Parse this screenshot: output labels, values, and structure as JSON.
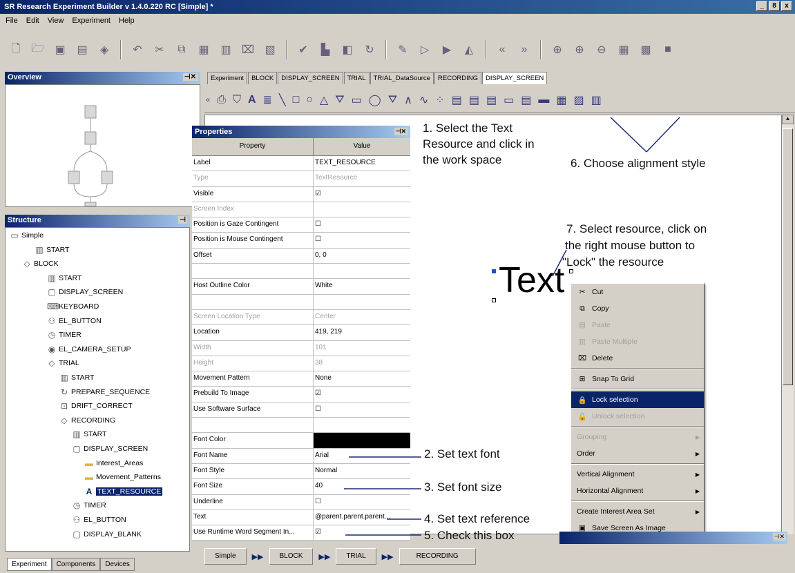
{
  "window": {
    "title": "SR Research Experiment Builder v 1.4.0.220 RC  [Simple] *",
    "min": "_",
    "max": "8",
    "close": "x"
  },
  "menu": [
    "File",
    "Edit",
    "View",
    "Experiment",
    "Help"
  ],
  "overview": {
    "title": "Overview"
  },
  "structure": {
    "title": "Structure",
    "items": [
      {
        "label": "Simple",
        "icon": "project-icon"
      },
      {
        "label": "START",
        "icon": "start-icon"
      },
      {
        "label": "BLOCK",
        "icon": "sequence-icon"
      },
      {
        "label": "START",
        "icon": "start-icon"
      },
      {
        "label": "DISPLAY_SCREEN",
        "icon": "display-icon"
      },
      {
        "label": "KEYBOARD",
        "icon": "keyboard-icon"
      },
      {
        "label": "EL_BUTTON",
        "icon": "button-icon"
      },
      {
        "label": "TIMER",
        "icon": "timer-icon"
      },
      {
        "label": "EL_CAMERA_SETUP",
        "icon": "camera-icon"
      },
      {
        "label": "TRIAL",
        "icon": "sequence-icon"
      },
      {
        "label": "START",
        "icon": "start-icon"
      },
      {
        "label": "PREPARE_SEQUENCE",
        "icon": "prepare-icon"
      },
      {
        "label": "DRIFT_CORRECT",
        "icon": "drift-icon"
      },
      {
        "label": "RECORDING",
        "icon": "sequence-icon"
      },
      {
        "label": "START",
        "icon": "start-icon"
      },
      {
        "label": "DISPLAY_SCREEN",
        "icon": "display-icon"
      },
      {
        "label": "Interest_Areas",
        "icon": "folder-icon"
      },
      {
        "label": "Movement_Patterns",
        "icon": "folder-icon"
      },
      {
        "label": "TEXT_RESOURCE",
        "icon": "text-icon"
      },
      {
        "label": "TIMER",
        "icon": "timer-icon"
      },
      {
        "label": "EL_BUTTON",
        "icon": "button-icon"
      },
      {
        "label": "DISPLAY_BLANK",
        "icon": "display-icon"
      }
    ]
  },
  "bottom_tabs": [
    "Experiment",
    "Components",
    "Devices"
  ],
  "editor_tabs": [
    "Experiment",
    "BLOCK",
    "DISPLAY_SCREEN",
    "TRIAL",
    "TRIAL_DataSource",
    "RECORDING",
    "DISPLAY_SCREEN"
  ],
  "properties": {
    "title": "Properties",
    "col_property": "Property",
    "col_value": "Value",
    "rows": [
      {
        "p": "Label",
        "v": "TEXT_RESOURCE"
      },
      {
        "p": "Type",
        "v": "TextResource",
        "dim": true
      },
      {
        "p": "Visible",
        "v": "☑"
      },
      {
        "p": "Screen Index",
        "v": "",
        "dim": true
      },
      {
        "p": "Position is Gaze Contingent",
        "v": "☐"
      },
      {
        "p": "Position is Mouse Contingent",
        "v": "☐"
      },
      {
        "p": "Offset",
        "v": "0, 0"
      },
      {
        "p": "",
        "v": ""
      },
      {
        "p": "Host Outline Color",
        "v": "White"
      },
      {
        "p": "",
        "v": ""
      },
      {
        "p": "Screen Location Type",
        "v": "Center",
        "dim": true
      },
      {
        "p": "Location",
        "v": "419, 219"
      },
      {
        "p": "Width",
        "v": "101",
        "dim": true
      },
      {
        "p": "Height",
        "v": "38",
        "dim": true
      },
      {
        "p": "Movement Pattern",
        "v": "None"
      },
      {
        "p": "Prebuild To Image",
        "v": "☑"
      },
      {
        "p": "Use Software Surface",
        "v": "☐"
      },
      {
        "p": "",
        "v": ""
      },
      {
        "p": "Font Color",
        "v": ""
      },
      {
        "p": "Font Name",
        "v": "Arial"
      },
      {
        "p": "Font Style",
        "v": "Normal"
      },
      {
        "p": "Font Size",
        "v": "40"
      },
      {
        "p": "Underline",
        "v": "☐"
      },
      {
        "p": "Text",
        "v": "@parent.parent.parent..."
      },
      {
        "p": "Use Runtime Word Segment In...",
        "v": "☑"
      }
    ]
  },
  "canvas": {
    "sample_text": "Text"
  },
  "annotations": {
    "a1": "1. Select the Text",
    "a1b": "Resource and click in",
    "a1c": "the work space",
    "a2": "2. Set text font",
    "a3": "3. Set font size",
    "a4": "4. Set text reference",
    "a5": "5. Check this box",
    "a6": "6. Choose alignment style",
    "a7": "7. Select resource, click on",
    "a7b": "the right mouse button to",
    "a7c": "\"Lock\" the resource"
  },
  "context_menu": [
    {
      "label": "Cut",
      "icon": "cut-icon"
    },
    {
      "label": "Copy",
      "icon": "copy-icon"
    },
    {
      "label": "Paste",
      "icon": "paste-icon",
      "dim": true
    },
    {
      "label": "Paste Multiple",
      "icon": "paste-multiple-icon",
      "dim": true
    },
    {
      "label": "Delete",
      "icon": "delete-icon"
    },
    {
      "label": "Snap To Grid",
      "icon": "snap-icon"
    },
    {
      "label": "Lock selection",
      "icon": "lock-icon",
      "sel": true
    },
    {
      "label": "Unlock selection",
      "icon": "unlock-icon",
      "dim": true
    },
    {
      "label": "Grouping",
      "dim": true,
      "sub": true
    },
    {
      "label": "Order",
      "sub": true
    },
    {
      "label": "Vertical Alignment",
      "sub": true
    },
    {
      "label": "Horizontal Alignment",
      "sub": true
    },
    {
      "label": "Create Interest Area Set",
      "sub": true
    },
    {
      "label": "Save Screen As Image",
      "icon": "save-image-icon"
    }
  ],
  "breadcrumbs": [
    "Simple",
    "BLOCK",
    "TRIAL",
    "RECORDING"
  ]
}
